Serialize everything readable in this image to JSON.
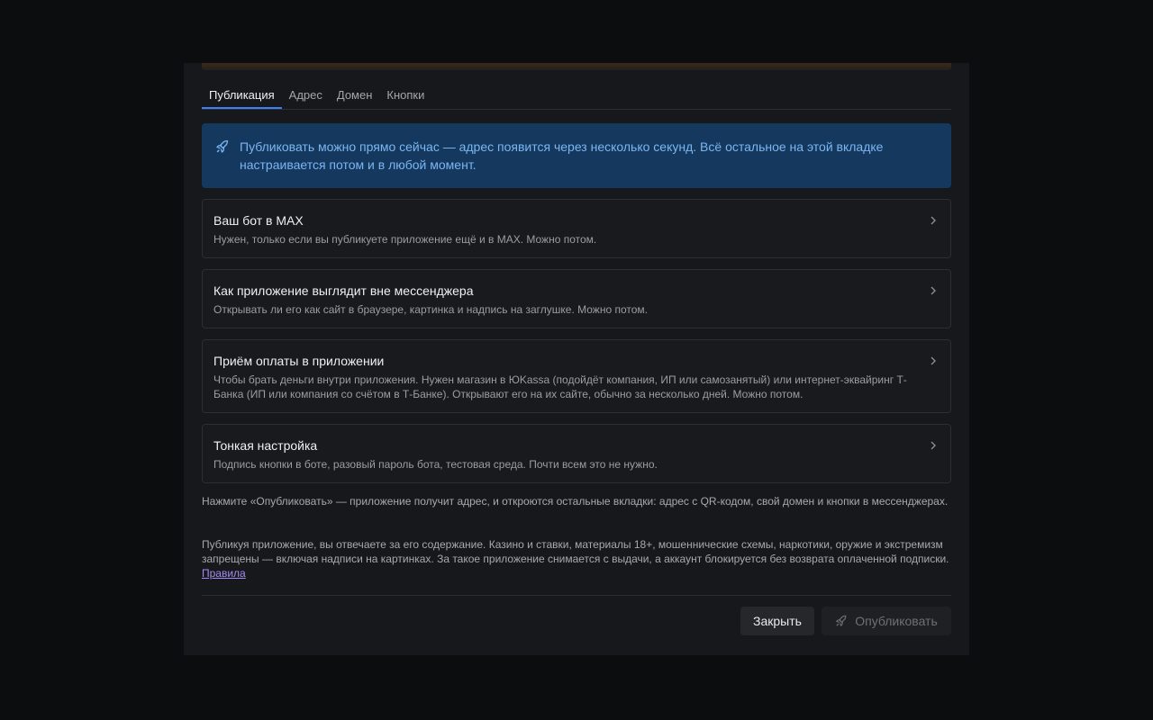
{
  "tabs": [
    {
      "label": "Публикация",
      "active": true
    },
    {
      "label": "Адрес",
      "active": false
    },
    {
      "label": "Домен",
      "active": false
    },
    {
      "label": "Кнопки",
      "active": false
    }
  ],
  "banner": {
    "icon": "rocket-icon",
    "text": "Публиковать можно прямо сейчас — адрес появится через несколько секунд. Всё остальное на этой вкладке настраивается потом и в любой момент."
  },
  "cards": [
    {
      "title": "Ваш бот в MAX",
      "description": "Нужен, только если вы публикуете приложение ещё и в MAX. Можно потом."
    },
    {
      "title": "Как приложение выглядит вне мессенджера",
      "description": "Открывать ли его как сайт в браузере, картинка и надпись на заглушке. Можно потом."
    },
    {
      "title": "Приём оплаты в приложении",
      "description": "Чтобы брать деньги внутри приложения. Нужен магазин в ЮKassa (подойдёт компания, ИП или самозанятый) или интернет-эквайринг Т-Банка (ИП или компания со счётом в Т-Банке). Открывают его на их сайте, обычно за несколько дней. Можно потом."
    },
    {
      "title": "Тонкая настройка",
      "description": "Подпись кнопки в боте, разовый пароль бота, тестовая среда. Почти всем это не нужно."
    }
  ],
  "notes": {
    "publish_hint": "Нажмите «Опубликовать» — приложение получит адрес, и откроются остальные вкладки: адрес с QR-кодом, свой домен и кнопки в мессенджерах.",
    "responsibility": "Публикуя приложение, вы отвечаете за его содержание. Казино и ставки, материалы 18+, мошеннические схемы, наркотики, оружие и экстремизм запрещены — включая надписи на картинках. За такое приложение снимается с выдачи, а аккаунт блокируется без возврата оплаченной подписки.",
    "rules_link": "Правила"
  },
  "footer": {
    "close_label": "Закрыть",
    "publish_label": "Опубликовать",
    "publish_icon": "rocket-icon"
  },
  "colors": {
    "accent": "#3b82f6",
    "banner_bg": "#14385e",
    "banner_text": "#7bb6f2",
    "link": "#a48cf4"
  }
}
